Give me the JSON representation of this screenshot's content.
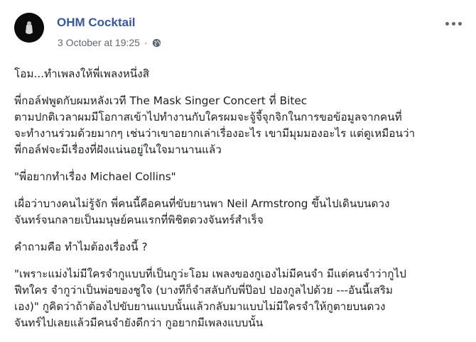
{
  "post": {
    "author": "OHM Cocktail",
    "timestamp": "3 October at 19:25",
    "separator": "·",
    "privacy_icon": "globe-icon",
    "more_icon": "more-options-icon",
    "paragraphs": [
      [
        "โอม...ทำเพลงให้พี่เพลงหนึ่งสิ"
      ],
      [
        "พี่กอล์ฟพูดกับผมหลังเวที The Mask Singer Concert ที่ Bitec",
        "ตามปกติเวลาผมมีโอกาสเข้าไปทำงานกับใครผมจะจู้จี้จุกจิกในการขอข้อมูลจากคนที่",
        "จะทำงานร่วมด้วยมากๆ เช่นว่าเขาอยากเล่าเรื่องอะไร เขามีมุมมองอะไร แต่ดูเหมือนว่า",
        "พี่กอล์ฟจะมีเรื่องที่ฝังแน่นอยู่ในใจมานานแล้ว"
      ],
      [
        "\"พี่อยากทำเรื่อง Michael Collins\""
      ],
      [
        "เผื่อว่าบางคนไม่รู้จัก พี่คนนี้คือคนที่ขับยานพา Neil Armstrong ขึ้นไปเดินบนดวง",
        "จันทร์จนกลายเป็นมนุษย์คนแรกที่พิชิตดวงจันทร์สำเร็จ"
      ],
      [
        "คำถามคือ ทำไมต้องเรื่องนี้ ?"
      ],
      [
        "\"เพราะแม่งไม่มีใครจำกูแบบที่เป็นกูว่ะโอม เพลงของกูเองไม่มีคนจำ มีแต่คนจำว่ากูไป",
        "ฟีทใคร จำกูว่าเป็นพ่อของชูใจ (บางทีก็จำสลับกับพี่ป๊อป ปองกูลไปด้วย ---อันนี้เสริม",
        "เอง)\" กูคิดว่าถ้าต้องไปขับยานแบบนั้นแล้วกลับมาแบบไม่มีใครจำให้กูตายบนดวง",
        "จันทร์ไปเลยแล้วมีคนจำยังดีกว่า กูอยากมีเพลงแบบนั้น"
      ]
    ]
  }
}
